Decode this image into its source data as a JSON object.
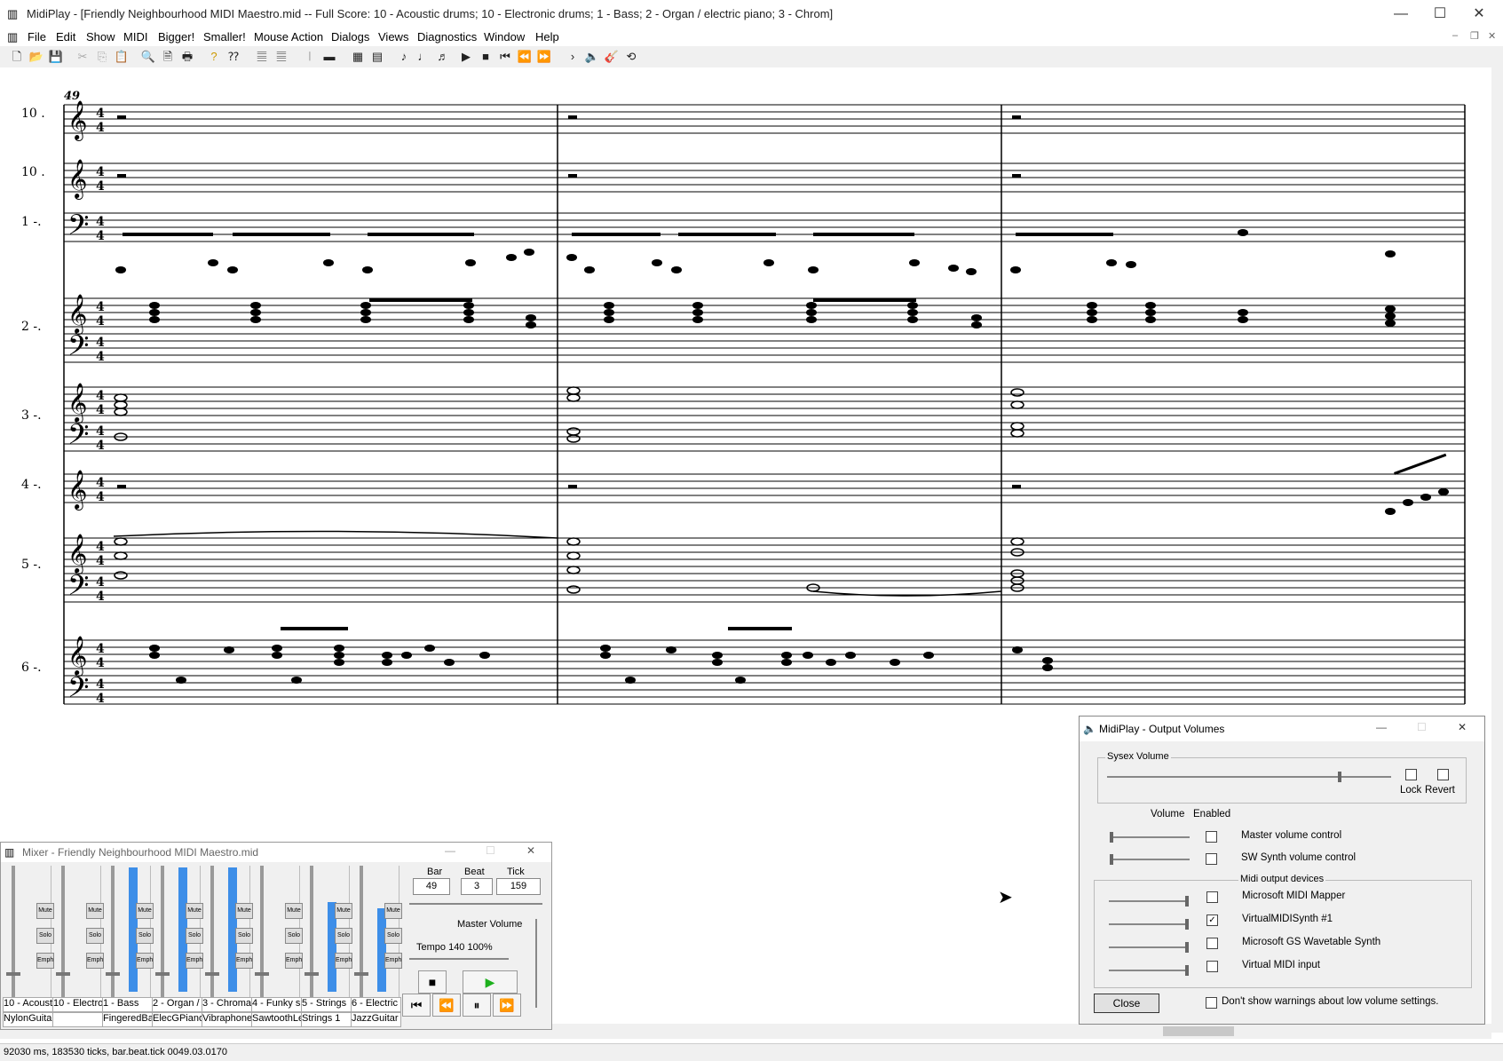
{
  "window": {
    "title": "MidiPlay - [Friendly Neighbourhood MIDI Maestro.mid -- Full Score: 10 - Acoustic drums; 10 - Electronic drums; 1 - Bass; 2 - Organ / electric piano; 3 - Chrom]"
  },
  "menu": [
    "File",
    "Edit",
    "Show",
    "MIDI",
    "Bigger!",
    "Smaller!",
    "Mouse Action",
    "Dialogs",
    "Views",
    "Diagnostics",
    "Window",
    "Help"
  ],
  "score": {
    "bar_number": "49",
    "staff_labels": [
      "10 .",
      "10 .",
      "1 -.",
      "2 -.",
      "3 -.",
      "4 -.",
      "5 -.",
      "6 -."
    ],
    "time_signature": "4/4"
  },
  "status": {
    "text": "92030 ms, 183530 ticks, bar.beat.tick 0049.03.0170"
  },
  "mixer": {
    "title": "Mixer - Friendly Neighbourhood MIDI Maestro.mid",
    "channels": [
      {
        "name": "10 - Acoust",
        "instrument": "NylonGuitar",
        "level": 0
      },
      {
        "name": "10 - Electro",
        "instrument": "",
        "level": 0
      },
      {
        "name": "1 - Bass",
        "instrument": "FingeredBa",
        "level": 1.0
      },
      {
        "name": "2 - Organ /",
        "instrument": "ElecGPiano",
        "level": 1.0
      },
      {
        "name": "3 - Chromat",
        "instrument": "Vibraphone",
        "level": 1.0
      },
      {
        "name": "4 - Funky s",
        "instrument": "SawtoothLe",
        "level": 0
      },
      {
        "name": "5 - Strings",
        "instrument": "Strings 1",
        "level": 0.72
      },
      {
        "name": "6 - Electric",
        "instrument": "JazzGuitar",
        "level": 0.67
      }
    ],
    "buttons": {
      "mute": "Mute",
      "solo": "Solo",
      "emph": "Emph"
    },
    "position": {
      "bar_label": "Bar",
      "beat_label": "Beat",
      "tick_label": "Tick",
      "bar": "49",
      "beat": "3",
      "tick": "159"
    },
    "master_volume_label": "Master Volume",
    "tempo_label": "Tempo 140 100%"
  },
  "output_volumes": {
    "title": "MidiPlay - Output Volumes",
    "sysex_label": "Sysex Volume",
    "lock_label": "Lock",
    "revert_label": "Revert",
    "volume_header": "Volume",
    "enabled_header": "Enabled",
    "rows": [
      {
        "label": "Master volume control",
        "checked": false
      },
      {
        "label": "SW Synth volume control",
        "checked": false
      }
    ],
    "devices_label": "Midi output devices",
    "devices": [
      {
        "label": "Microsoft MIDI Mapper",
        "checked": false
      },
      {
        "label": "VirtualMIDISynth #1",
        "checked": true
      },
      {
        "label": "Microsoft GS Wavetable Synth",
        "checked": false
      },
      {
        "label": "Virtual MIDI input",
        "checked": false
      }
    ],
    "close_label": "Close",
    "warn_label": "Don't show warnings about low volume settings."
  },
  "colors": {
    "accent": "#3d8ee8",
    "play": "#1db01d"
  }
}
